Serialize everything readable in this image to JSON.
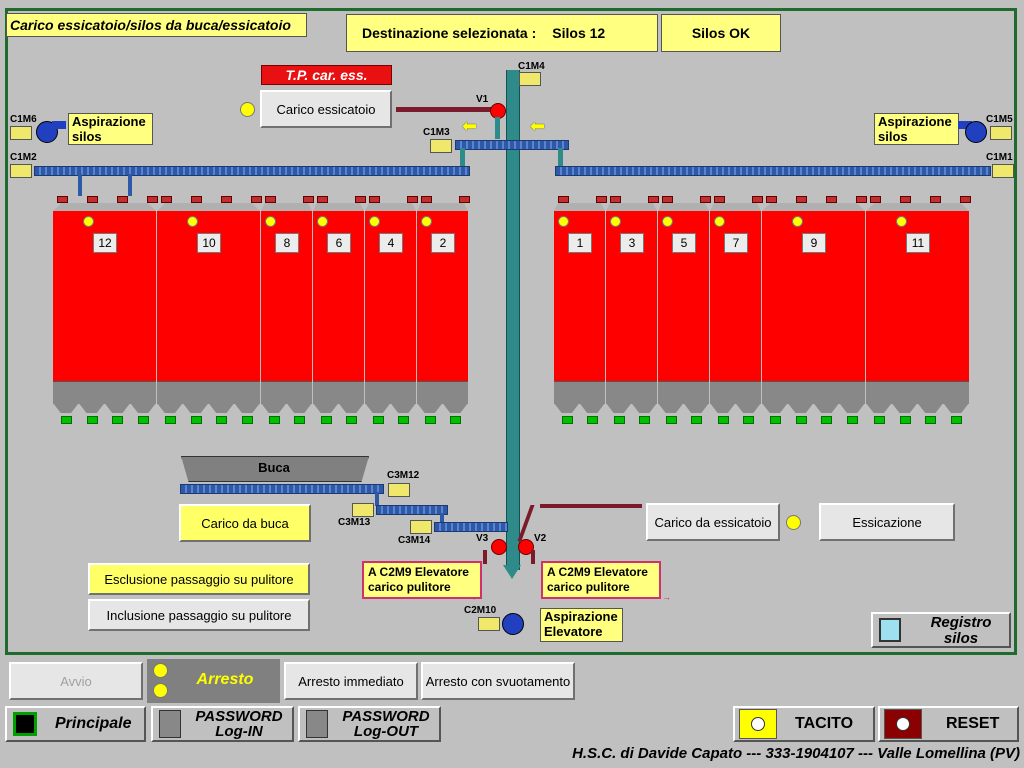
{
  "title": "Carico essicatoio/silos da buca/essicatoio",
  "destination": {
    "label": "Destinazione selezionata :",
    "value": "Silos 12",
    "status": "Silos OK"
  },
  "tp_label": "T.P. car. ess.",
  "carico_essicatoio_btn": "Carico essicatoio",
  "aspirazione_silos": "Aspirazione silos",
  "aspirazione_elevatore": "Aspirazione Elevatore",
  "motors": {
    "c1m4": "C1M4",
    "c1m6": "C1M6",
    "c1m5": "C1M5",
    "c1m2": "C1M2",
    "c1m1": "C1M1",
    "c1m3": "C1M3",
    "c3m12": "C3M12",
    "c3m13": "C3M13",
    "c3m14": "C3M14",
    "c2m10": "C2M10"
  },
  "valves": {
    "v1": "V1",
    "v2": "V2",
    "v3": "V3"
  },
  "silos_left": [
    "12",
    "10",
    "8",
    "6",
    "4",
    "2"
  ],
  "silos_right": [
    "1",
    "3",
    "5",
    "7",
    "9",
    "11"
  ],
  "buca": "Buca",
  "carico_da_buca": "Carico da buca",
  "carico_da_essicatoio": "Carico da essicatoio",
  "essicazione": "Essicazione",
  "elev_label_left": "A C2M9 Elevatore carico pulitore",
  "elev_label_right": "A C2M9 Elevatore carico pulitore",
  "esclusione": "Esclusione passaggio su pulitore",
  "inclusione": "Inclusione passaggio su pulitore",
  "registro": "Registro silos",
  "avvio": "Avvio",
  "arresto": "Arresto",
  "arresto_immediato": "Arresto immediato",
  "arresto_svuotamento": "Arresto con svuotamento",
  "principale": "Principale",
  "pwd_login": "PASSWORD Log-IN",
  "pwd_logout": "PASSWORD Log-OUT",
  "tacito": "TACITO",
  "reset": "RESET",
  "footer": "H.S.C. di Davide Capato --- 333-1904107 --- Valle Lomellina (PV)",
  "colors": {
    "silo": "#ff0000",
    "accent_yellow": "#ffff66",
    "frame": "#1f6b2e",
    "conveyor": "#2e58a8",
    "elevator": "#2f8a8a"
  }
}
